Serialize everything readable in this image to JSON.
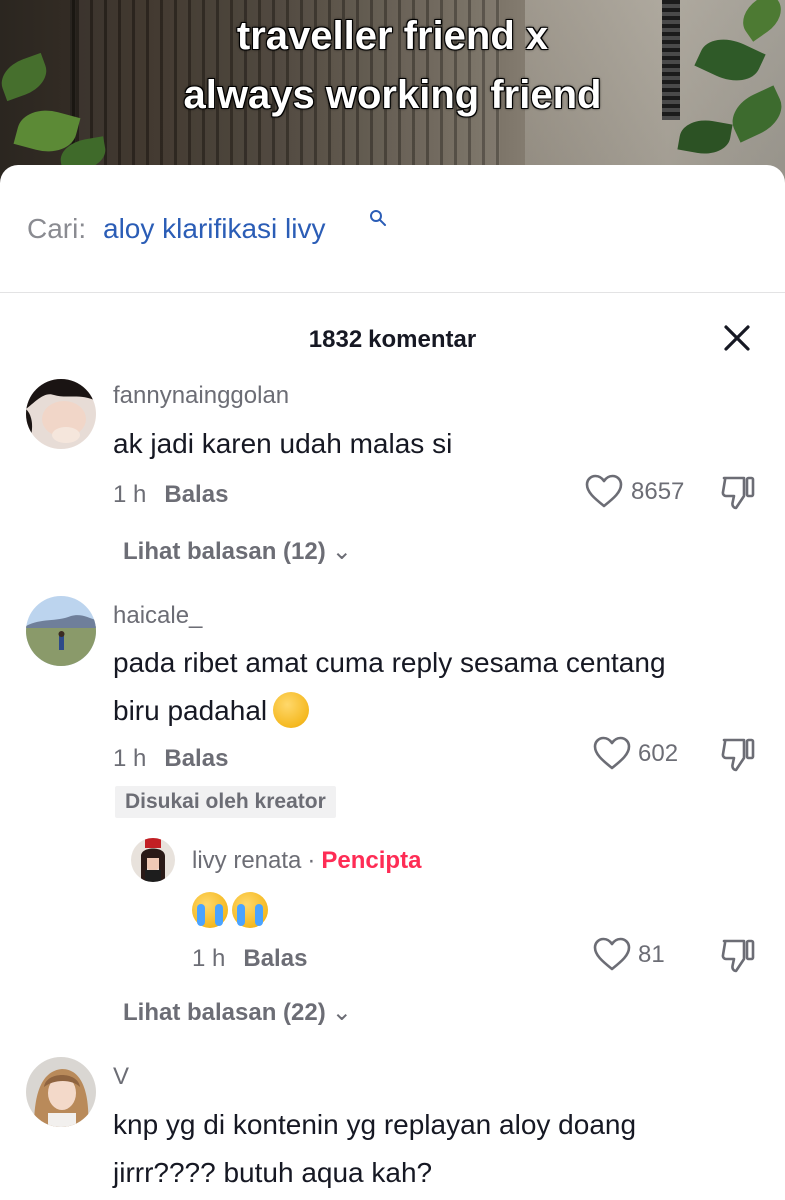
{
  "video": {
    "caption_line1": "traveller friend x",
    "caption_line2": "always working friend"
  },
  "search": {
    "prefix": "Cari:",
    "query": "aloy klarifikasi livy"
  },
  "header": {
    "count": "1832",
    "label": "komentar"
  },
  "comments": [
    {
      "username": "fannynainggolan",
      "text": "ak jadi karen udah malas si",
      "time": "1 h",
      "reply_label": "Balas",
      "likes": "8657",
      "view_replies": "Lihat balasan (12)"
    },
    {
      "username": "haicale_",
      "text_line1": "pada ribet amat cuma reply sesama centang",
      "text_line2": "biru padahal",
      "emoji": "weary-face-emoji",
      "time": "1 h",
      "reply_label": "Balas",
      "likes": "602",
      "liked_by_creator": "Disukai oleh kreator",
      "reply": {
        "username": "livy renata",
        "separator": "·",
        "creator_tag": "Pencipta",
        "emoji": "crying-face-emoji x2",
        "time": "1 h",
        "reply_label": "Balas",
        "likes": "81"
      },
      "view_replies": "Lihat balasan (22)"
    },
    {
      "username": "V",
      "text_line1": "knp yg di kontenin yg replayan aloy doang",
      "text_line2": "jirrr???? butuh aqua kah?"
    }
  ],
  "colors": {
    "search_link": "#2b5db6",
    "creator_tag": "#fe2c55",
    "muted": "#6c6d75",
    "text": "#161823"
  }
}
